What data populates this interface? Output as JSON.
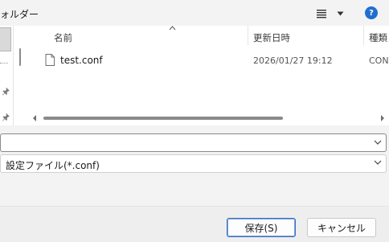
{
  "toolbar": {
    "folder_label": "ォルダー",
    "view_icon": "list-view-icon",
    "dropdown_icon": "caret-down-icon",
    "help_label": "?",
    "help_color": "#1f6fd1"
  },
  "nav": {
    "pin_icon": "pin-icon"
  },
  "filelist": {
    "columns": [
      "名前",
      "更新日時",
      "種類"
    ],
    "sort_icon": "sort-ascending-caret-icon",
    "files": [
      {
        "name": "test.conf",
        "modified": "2026/01/27 19:12",
        "type": "CON",
        "icon": "file-icon"
      }
    ]
  },
  "form": {
    "filename_value": "",
    "filetype_value": "設定ファイル(*.conf)"
  },
  "buttons": {
    "save_label": "保存(S)",
    "cancel_label": "キャンセル"
  },
  "colors": {
    "accent": "#3c6fbf",
    "window_bg": "#f3f3f3",
    "list_bg": "#ffffff"
  }
}
